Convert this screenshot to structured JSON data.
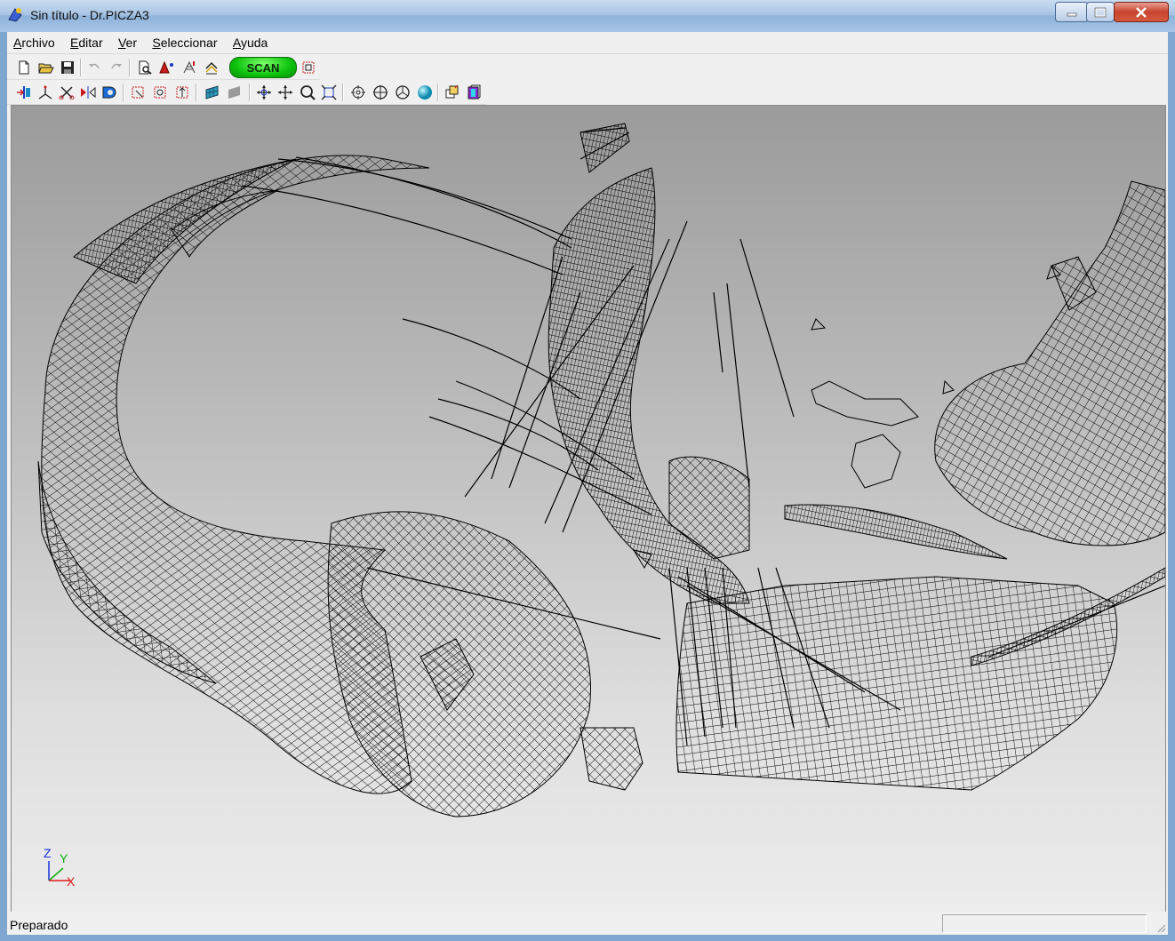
{
  "window": {
    "title": "Sin título - Dr.PICZA3",
    "controls": {
      "minimize": "minimize-icon",
      "maximize": "maximize-icon",
      "close": "close-icon"
    }
  },
  "menu": {
    "items": [
      {
        "label": "Archivo"
      },
      {
        "label": "Editar"
      },
      {
        "label": "Ver"
      },
      {
        "label": "Seleccionar"
      },
      {
        "label": "Ayuda"
      }
    ]
  },
  "toolbar1": {
    "buttons": [
      "new-file-icon",
      "open-folder-icon",
      "save-icon",
      "undo-icon",
      "redo-icon",
      "print-preview-icon",
      "scan-settings-icon",
      "scan-area-icon",
      "scan-up-icon"
    ],
    "scan_label": "SCAN",
    "after_scan": "select-region-icon"
  },
  "toolbar2": {
    "buttons": [
      "mirror-icon",
      "axis-icon",
      "cut-icon",
      "flip-icon",
      "mask-icon",
      "select-box-icon",
      "select-lasso-icon",
      "select-move-icon",
      "shade-icon",
      "flat-icon",
      "rotate-icon",
      "pan-icon",
      "zoom-icon",
      "fit-icon",
      "target-icon",
      "crosshair-icon",
      "view-point-icon",
      "sphere-icon",
      "layers-icon",
      "color-icon"
    ]
  },
  "viewport": {
    "axes": {
      "z": "Z",
      "y": "Y",
      "x": "X"
    },
    "colors": {
      "mesh": "#000000",
      "axis_x": "#e01818",
      "axis_y": "#10b010",
      "axis_z": "#1830e0"
    }
  },
  "status": {
    "text": "Preparado"
  }
}
